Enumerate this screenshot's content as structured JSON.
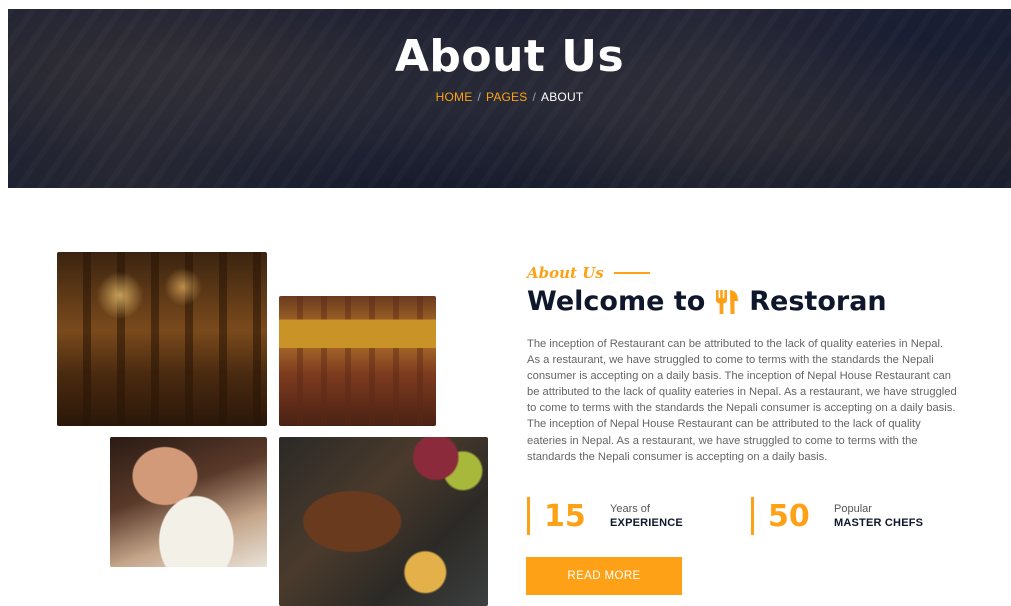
{
  "hero": {
    "title": "About Us",
    "breadcrumb": [
      {
        "label": "HOME"
      },
      {
        "label": "PAGES"
      },
      {
        "label": "ABOUT"
      }
    ],
    "separator": "/"
  },
  "about": {
    "eyebrow": "About Us",
    "heading_prefix": "Welcome to",
    "heading_brand": "Restoran",
    "paragraph": "The inception of Restaurant can be attributed to the lack of quality eateries in Nepal. As a restaurant, we have struggled to come to terms with the standards the Nepali consumer is accepting on a daily basis. The inception of Nepal House Restaurant can be attributed to the lack of quality eateries in Nepal. As a restaurant, we have struggled to come to terms with the standards the Nepali consumer is accepting on a daily basis. The inception of Nepal House Restaurant can be attributed to the lack of quality eateries in Nepal. As a restaurant, we have struggled to come to terms with the standards the Nepali consumer is accepting on a daily basis.",
    "stats": [
      {
        "number": "15",
        "small": "Years of",
        "big": "EXPERIENCE"
      },
      {
        "number": "50",
        "small": "Popular",
        "big": "MASTER CHEFS"
      }
    ],
    "button_label": "READ MORE"
  },
  "colors": {
    "accent": "#FEA116",
    "dark": "#0F172B",
    "body_text": "#666565",
    "hero_bg": "#171b2e"
  },
  "icons": {
    "heading_icon": "utensils-icon"
  }
}
